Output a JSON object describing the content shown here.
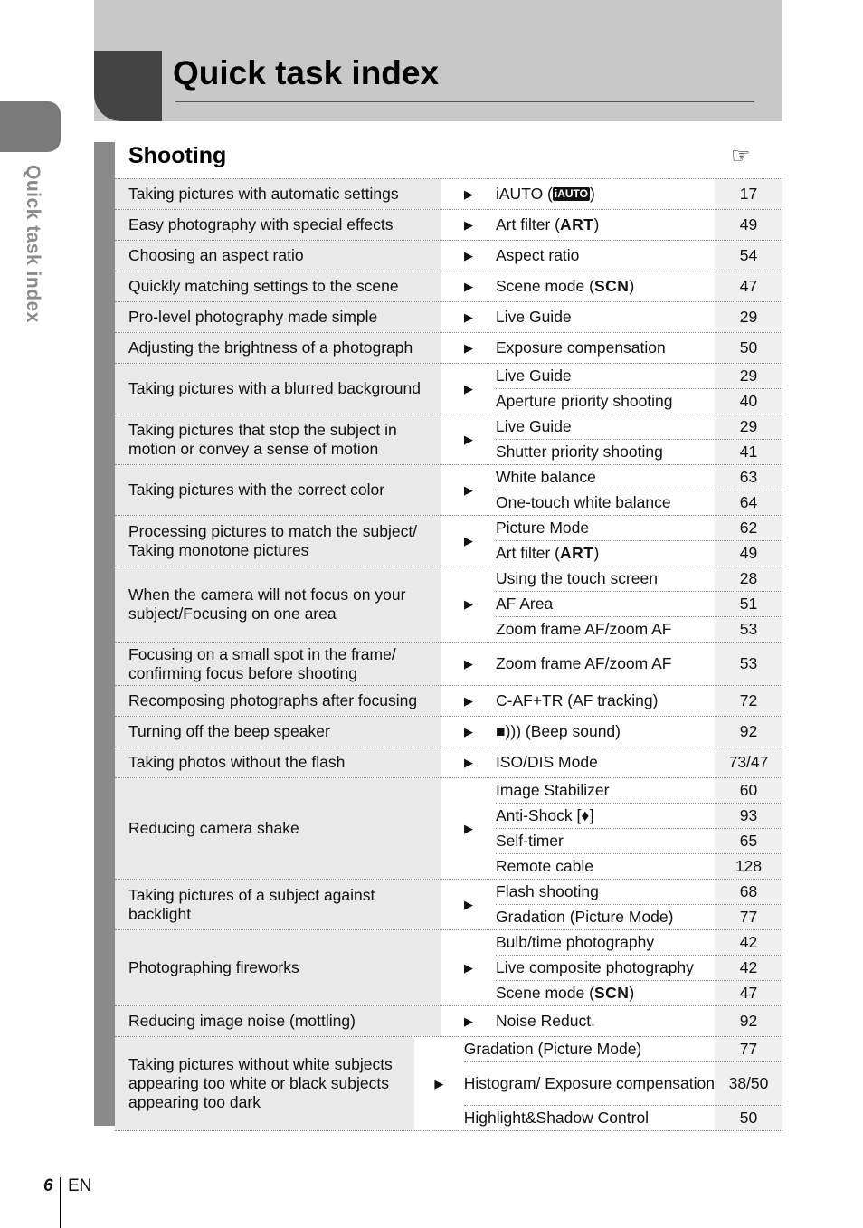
{
  "side_tab": {
    "label": "Quick task index"
  },
  "header": {
    "title": "Quick task index"
  },
  "section": {
    "title": "Shooting",
    "reference_icon": "pointing-hand-icon"
  },
  "rows": [
    {
      "task": "Taking pictures with automatic settings",
      "refs": [
        {
          "label": "iAUTO (",
          "badge": "iAUTO",
          "suffix": ")",
          "page": "17"
        }
      ]
    },
    {
      "task": "Easy photography with special effects",
      "refs": [
        {
          "label": "Art filter (",
          "bold": "ART",
          "suffix": ")",
          "page": "49"
        }
      ]
    },
    {
      "task": "Choosing an aspect ratio",
      "refs": [
        {
          "label": "Aspect ratio",
          "page": "54"
        }
      ]
    },
    {
      "task": "Quickly matching settings to the scene",
      "refs": [
        {
          "label": "Scene mode (",
          "bold": "SCN",
          "suffix": ")",
          "page": "47"
        }
      ]
    },
    {
      "task": "Pro-level photography made simple",
      "refs": [
        {
          "label": "Live Guide",
          "page": "29"
        }
      ]
    },
    {
      "task": "Adjusting the brightness of a photograph",
      "refs": [
        {
          "label": "Exposure compensation",
          "page": "50"
        }
      ]
    },
    {
      "task": "Taking pictures with a blurred background",
      "refs": [
        {
          "label": "Live Guide",
          "page": "29"
        },
        {
          "label": "Aperture priority shooting",
          "page": "40"
        }
      ]
    },
    {
      "task": "Taking pictures that stop the subject in motion or convey a sense of motion",
      "refs": [
        {
          "label": "Live Guide",
          "page": "29"
        },
        {
          "label": "Shutter priority shooting",
          "page": "41"
        }
      ]
    },
    {
      "task": "Taking pictures with the correct color",
      "refs": [
        {
          "label": "White balance",
          "page": "63"
        },
        {
          "label": "One-touch white balance",
          "page": "64"
        }
      ]
    },
    {
      "task": "Processing pictures to match the subject/ Taking monotone pictures",
      "refs": [
        {
          "label": "Picture Mode",
          "page": "62"
        },
        {
          "label": "Art filter (",
          "bold": "ART",
          "suffix": ")",
          "page": "49"
        }
      ]
    },
    {
      "task": "When the camera will not focus on your subject/Focusing on one area",
      "refs": [
        {
          "label": "Using the touch screen",
          "page": "28"
        },
        {
          "label": "AF Area",
          "page": "51"
        },
        {
          "label": "Zoom frame AF/zoom AF",
          "page": "53"
        }
      ]
    },
    {
      "task": "Focusing on a small spot in the frame/ confirming focus before shooting",
      "tall": true,
      "refs": [
        {
          "label": "Zoom frame AF/zoom AF",
          "page": "53"
        }
      ]
    },
    {
      "task": "Recomposing photographs after focusing",
      "refs": [
        {
          "label": "C-AF+TR (AF tracking)",
          "page": "72"
        }
      ]
    },
    {
      "task": "Turning off the beep speaker",
      "refs": [
        {
          "label": "■))) (Beep sound)",
          "page": "92"
        }
      ]
    },
    {
      "task": "Taking photos without the flash",
      "refs": [
        {
          "label": "ISO/DIS Mode",
          "page": "73/47"
        }
      ]
    },
    {
      "task": "Reducing camera shake",
      "refs": [
        {
          "label": "Image Stabilizer",
          "page": "60"
        },
        {
          "label": "Anti-Shock [",
          "bold": "♦",
          "suffix": "]",
          "page": "93"
        },
        {
          "label": "Self-timer",
          "page": "65"
        },
        {
          "label": "Remote cable",
          "page": "128"
        }
      ]
    },
    {
      "task": "Taking pictures of a subject against backlight",
      "refs": [
        {
          "label": "Flash shooting",
          "page": "68"
        },
        {
          "label": "Gradation (Picture Mode)",
          "page": "77"
        }
      ]
    },
    {
      "task": "Photographing fireworks",
      "refs": [
        {
          "label": "Bulb/time photography",
          "page": "42"
        },
        {
          "label": "Live composite photography",
          "page": "42"
        },
        {
          "label": "Scene mode (",
          "bold": "SCN",
          "suffix": ")",
          "page": "47"
        }
      ]
    },
    {
      "task": "Reducing image noise (mottling)",
      "refs": [
        {
          "label": "Noise Reduct.",
          "page": "92"
        }
      ]
    },
    {
      "task": "Taking pictures without white subjects appearing too white or black subjects appearing too dark",
      "refs": [
        {
          "label": "Gradation (Picture Mode)",
          "page": "77"
        },
        {
          "label": "Histogram/ Exposure compensation",
          "page": "38/50",
          "tall": true
        },
        {
          "label": "Highlight&Shadow Control",
          "page": "50"
        }
      ]
    }
  ],
  "footer": {
    "page_number": "6",
    "language": "EN"
  }
}
